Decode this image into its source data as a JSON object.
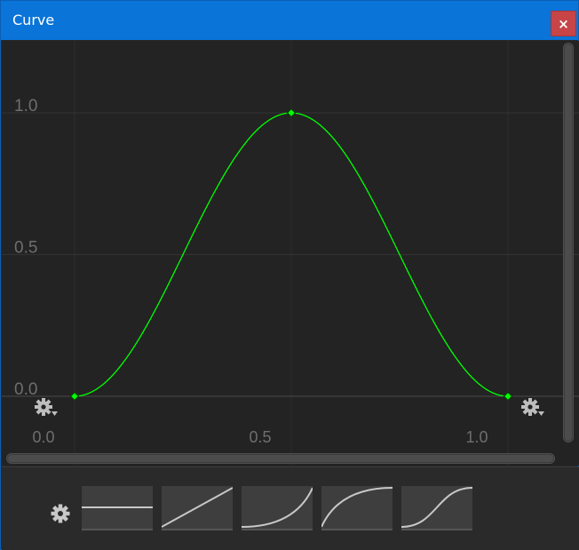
{
  "window": {
    "title": "Curve",
    "close_label": "×"
  },
  "curve": {
    "x_ticks": [
      "0.0",
      "0.5",
      "1.0"
    ],
    "y_ticks": [
      "0.0",
      "0.5",
      "1.0"
    ],
    "curve_color": "#00ff00",
    "keyframes": [
      {
        "time": 0.0,
        "value": 0.0
      },
      {
        "time": 0.5,
        "value": 1.0
      },
      {
        "time": 1.0,
        "value": 0.0
      }
    ]
  },
  "presets": [
    {
      "name": "constant"
    },
    {
      "name": "linear"
    },
    {
      "name": "ease-in"
    },
    {
      "name": "ease-out"
    },
    {
      "name": "ease-in-out"
    }
  ],
  "chart_data": {
    "type": "line",
    "x": [
      0.0,
      0.5,
      1.0
    ],
    "series": [
      {
        "values": [
          0.0,
          1.0,
          0.0
        ]
      }
    ],
    "xlim": [
      -0.1,
      1.15
    ],
    "ylim": [
      -0.2,
      1.2
    ],
    "grid": true
  }
}
